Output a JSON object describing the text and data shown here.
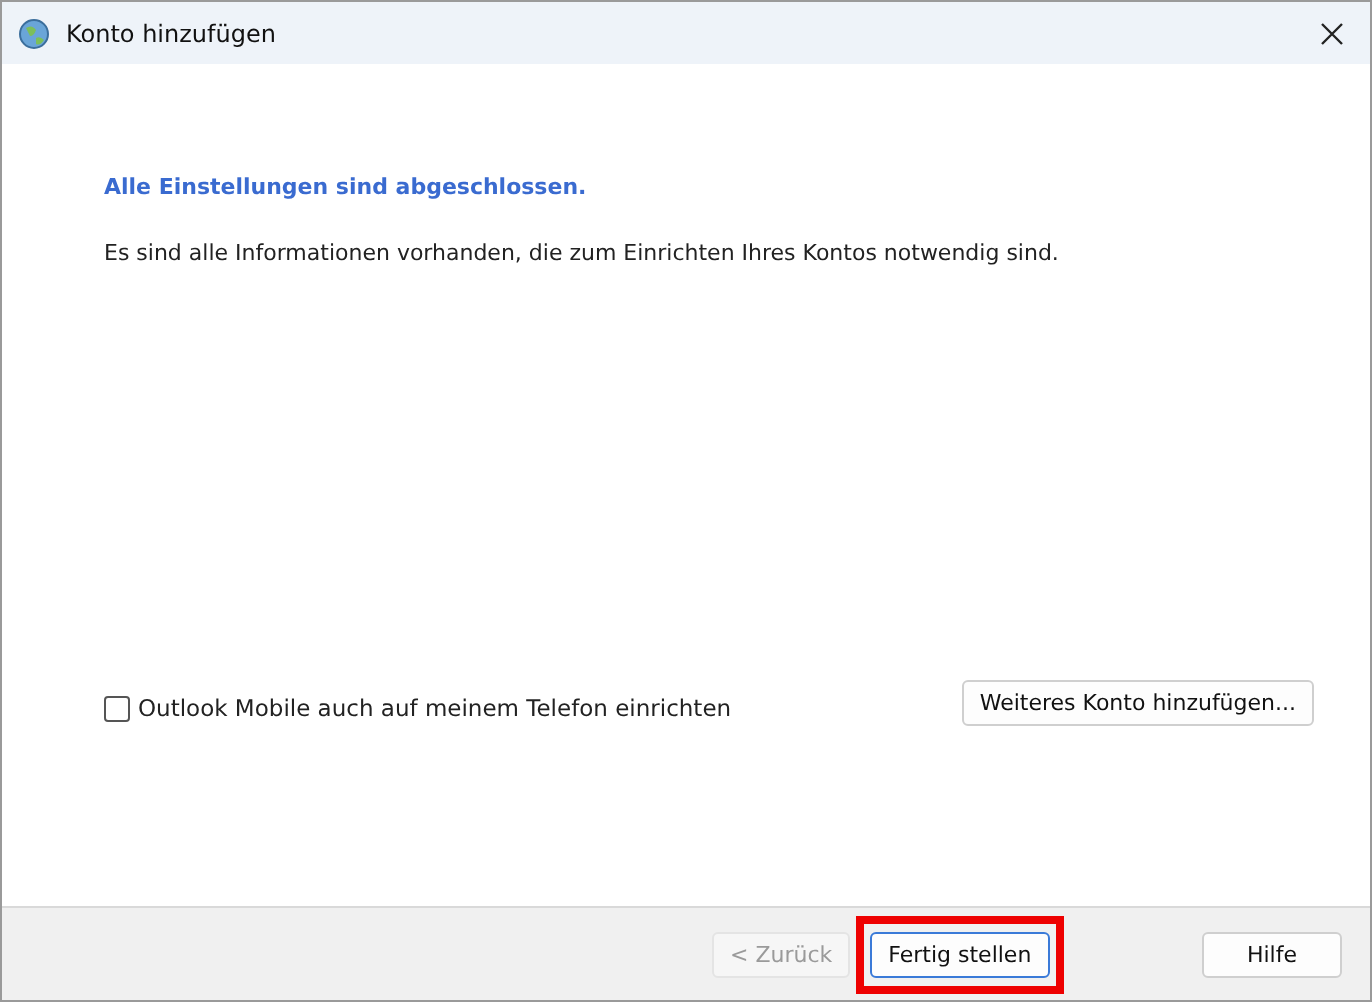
{
  "window": {
    "title": "Konto hinzufügen"
  },
  "heading": "Alle Einstellungen sind abgeschlossen.",
  "message": "Es sind alle Informationen vorhanden, die zum Einrichten Ihres Kontos notwendig sind.",
  "checkbox": {
    "label": "Outlook Mobile auch auf meinem Telefon einrichten",
    "checked": false
  },
  "add_account_button": "Weiteres Konto hinzufügen...",
  "buttons": [
    {
      "label": "< Zurück",
      "disabled": true,
      "highlighted": false,
      "default": false
    },
    {
      "label": "Fertig stellen",
      "disabled": false,
      "highlighted": true,
      "default": true
    },
    {
      "label": "Hilfe",
      "disabled": false,
      "highlighted": false,
      "default": false
    }
  ]
}
